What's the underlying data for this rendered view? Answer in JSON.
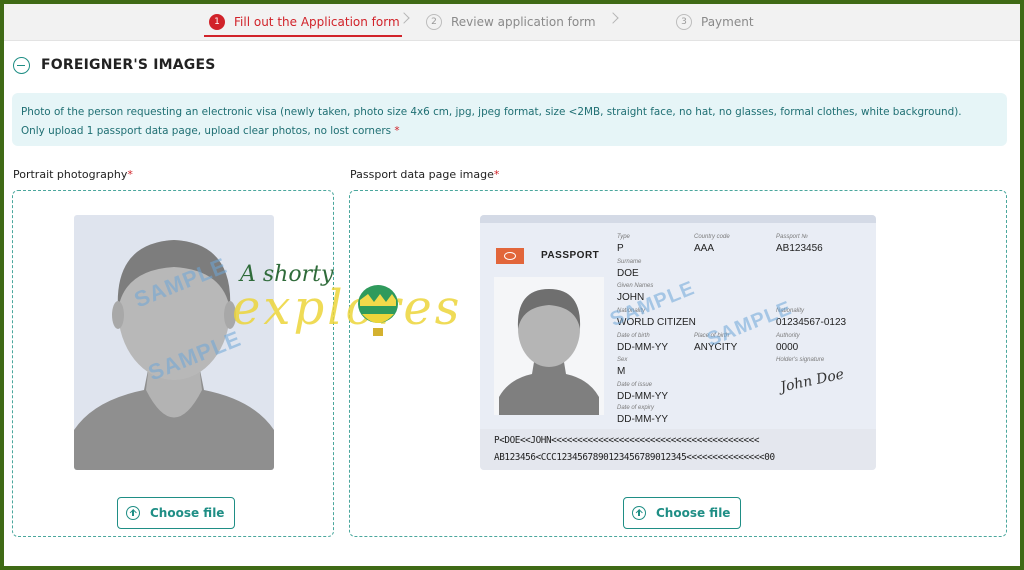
{
  "stepper": {
    "steps": [
      {
        "num": "1",
        "label": "Fill out the Application form"
      },
      {
        "num": "2",
        "label": "Review application form"
      },
      {
        "num": "3",
        "label": "Payment"
      }
    ]
  },
  "section": {
    "title": "FOREIGNER'S IMAGES"
  },
  "info": {
    "line1": "Photo of the person requesting an electronic visa (newly taken, photo size 4x6 cm, jpg, jpeg format, size <2MB, straight face, no hat, no glasses, formal clothes, white background).",
    "line2": "Only upload 1 passport data page, upload clear photos, no lost corners",
    "required": "*"
  },
  "portrait": {
    "label": "Portrait photography",
    "required": "*",
    "button": "Choose file",
    "watermark": "SAMPLE"
  },
  "passport": {
    "label": "Passport data page image",
    "required": "*",
    "button": "Choose file",
    "watermark": "SAMPLE",
    "card": {
      "title": "PASSPORT",
      "type_label": "Type",
      "type": "P",
      "country_label": "Country code",
      "country": "AAA",
      "number_label": "Passport №",
      "number": "AB123456",
      "surname_label": "Surname",
      "surname": "DOE",
      "given_label": "Given Names",
      "given": "JOHN",
      "nationality_label": "Nationality",
      "nationality": "WORLD CITIZEN",
      "personal_label": "Nationality",
      "personal": "01234567-0123",
      "dob_label": "Date of birth",
      "dob": "DD-MM-YY",
      "pob_label": "Place of birth",
      "pob": "ANYCITY",
      "authority_label": "Authority",
      "authority": "0000",
      "sex_label": "Sex",
      "sex": "M",
      "signature_label": "Holder's signature",
      "signature": "John Doe",
      "issue_label": "Date of issue",
      "issue": "DD-MM-YY",
      "expiry_label": "Date of expiry",
      "expiry": "DD-MM-YY",
      "mrz1": "P<DOE<<JOHN<<<<<<<<<<<<<<<<<<<<<<<<<<<<<<<<<<<<<<<<",
      "mrz2": "AB123456<CCC1234567890123456789012345<<<<<<<<<<<<<<<00"
    }
  },
  "overlay_logo": {
    "top": "A shorty",
    "bottom": "explores"
  },
  "colors": {
    "accent": "#1f8e85",
    "active_step": "#d1232a",
    "info_bg": "#e6f5f7",
    "frame": "#3f6a16"
  }
}
